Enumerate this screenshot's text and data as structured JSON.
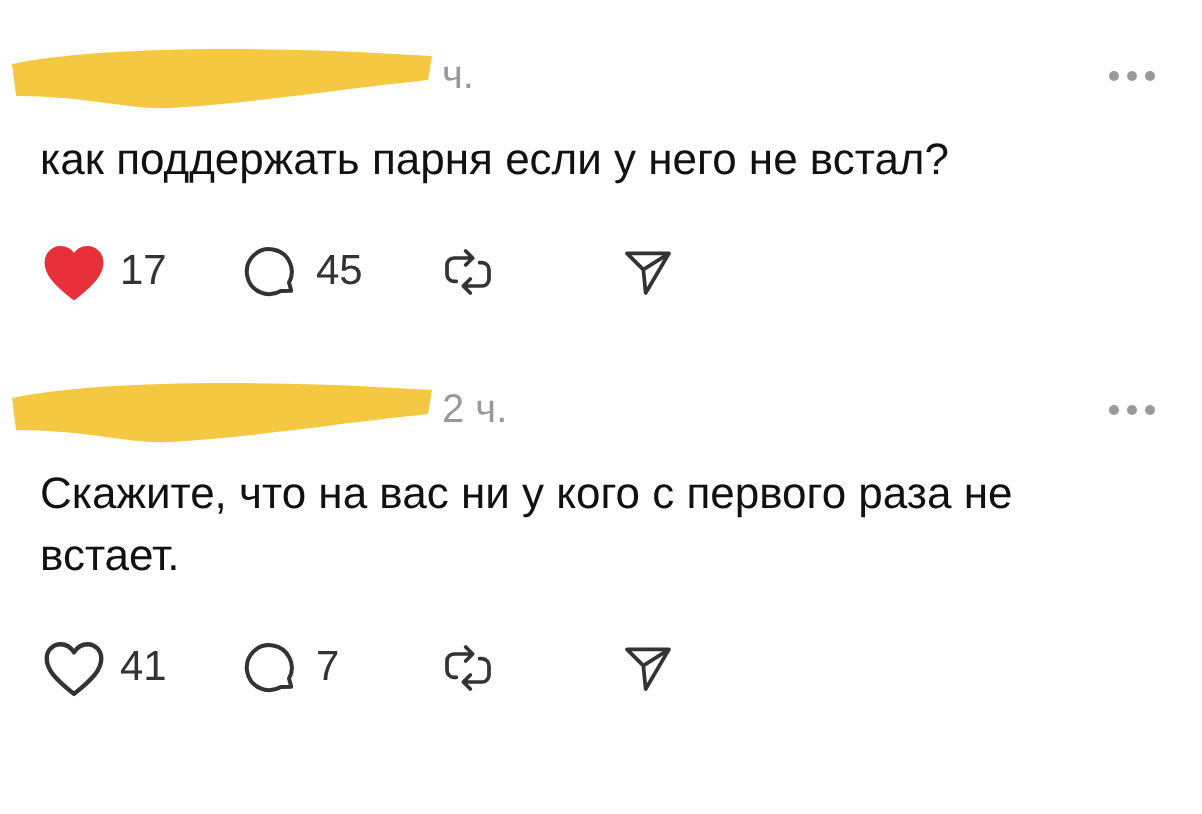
{
  "posts": [
    {
      "time": "ч.",
      "text": "как поддержать парня если у него не встал?",
      "liked": true,
      "likes": "17",
      "replies": "45"
    },
    {
      "time": "2 ч.",
      "text": "Скажите, что на вас ни у кого с первого раза не встает.",
      "liked": false,
      "likes": "41",
      "replies": "7"
    }
  ]
}
